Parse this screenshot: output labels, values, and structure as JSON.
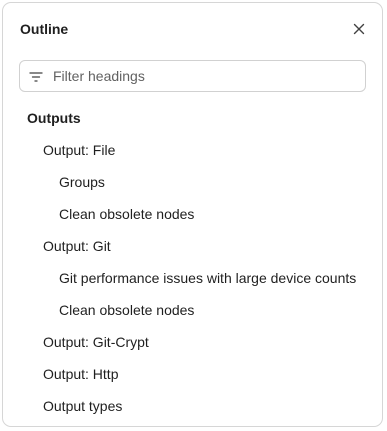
{
  "panel": {
    "title": "Outline",
    "close_icon": "close-icon"
  },
  "search": {
    "icon": "filter-icon",
    "placeholder": "Filter headings",
    "value": ""
  },
  "headings": [
    {
      "label": "Outputs",
      "level": 0
    },
    {
      "label": "Output: File",
      "level": 1
    },
    {
      "label": "Groups",
      "level": 2
    },
    {
      "label": "Clean obsolete nodes",
      "level": 2
    },
    {
      "label": "Output: Git",
      "level": 1
    },
    {
      "label": "Git performance issues with large device counts",
      "level": 2
    },
    {
      "label": "Clean obsolete nodes",
      "level": 2
    },
    {
      "label": "Output: Git-Crypt",
      "level": 1
    },
    {
      "label": "Output: Http",
      "level": 1
    },
    {
      "label": "Output types",
      "level": 1
    }
  ]
}
